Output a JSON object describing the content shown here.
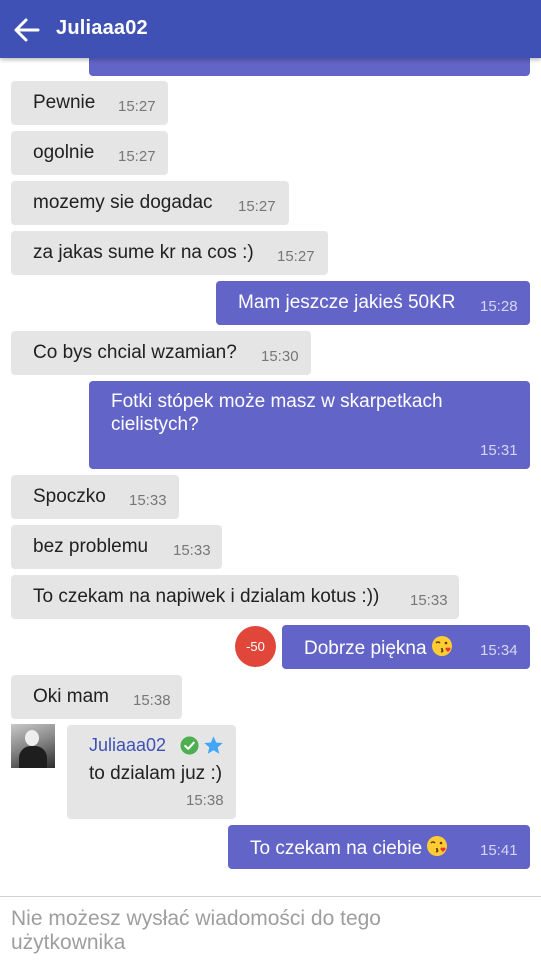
{
  "header": {
    "title": "Juliaaa02",
    "back_icon": "arrow-left-icon"
  },
  "messages": [
    {
      "direction": "in",
      "text": "Pewnie",
      "time": "15:27"
    },
    {
      "direction": "in",
      "text": "ogolnie",
      "time": "15:27"
    },
    {
      "direction": "in",
      "text": "mozemy sie dogadac",
      "time": "15:27"
    },
    {
      "direction": "in",
      "text": "za jakas sume kr na cos :)",
      "time": "15:27"
    },
    {
      "direction": "out",
      "text": "Mam jeszcze jakieś 50KR",
      "time": "15:28"
    },
    {
      "direction": "in",
      "text": "Co bys chcial wzamian?",
      "time": "15:30"
    },
    {
      "direction": "out",
      "text_line1": "Fotki stópek może masz w skarpetkach",
      "text_line2": "cielistych?",
      "time": "15:31"
    },
    {
      "direction": "in",
      "text": "Spoczko",
      "time": "15:33"
    },
    {
      "direction": "in",
      "text": "bez problemu",
      "time": "15:33"
    },
    {
      "direction": "in",
      "text": "To czekam na napiwek i dzialam kotus :))",
      "time": "15:33"
    },
    {
      "direction": "out",
      "text": "Dobrze piękna",
      "emoji": "kiss-emoji",
      "badge": "-50",
      "time": "15:34"
    },
    {
      "direction": "in",
      "text": "Oki mam",
      "time": "15:38"
    },
    {
      "direction": "in",
      "sender": "Juliaaa02",
      "sender_icons": [
        "verified-check-icon",
        "star-icon"
      ],
      "text": "to dzialam juz :)",
      "time": "15:38"
    },
    {
      "direction": "out",
      "text": "To czekam na ciebie",
      "emoji": "kiss-emoji",
      "time": "15:41"
    }
  ],
  "footer": {
    "notice": "Nie możesz wysłać wiadomości do tego użytkownika"
  },
  "colors": {
    "header": "#3f51b5",
    "outgoing": "#6364c8",
    "incoming": "#e5e5e5",
    "badge": "#e0473a",
    "verified": "#4caf50",
    "star": "#42a5f5"
  }
}
